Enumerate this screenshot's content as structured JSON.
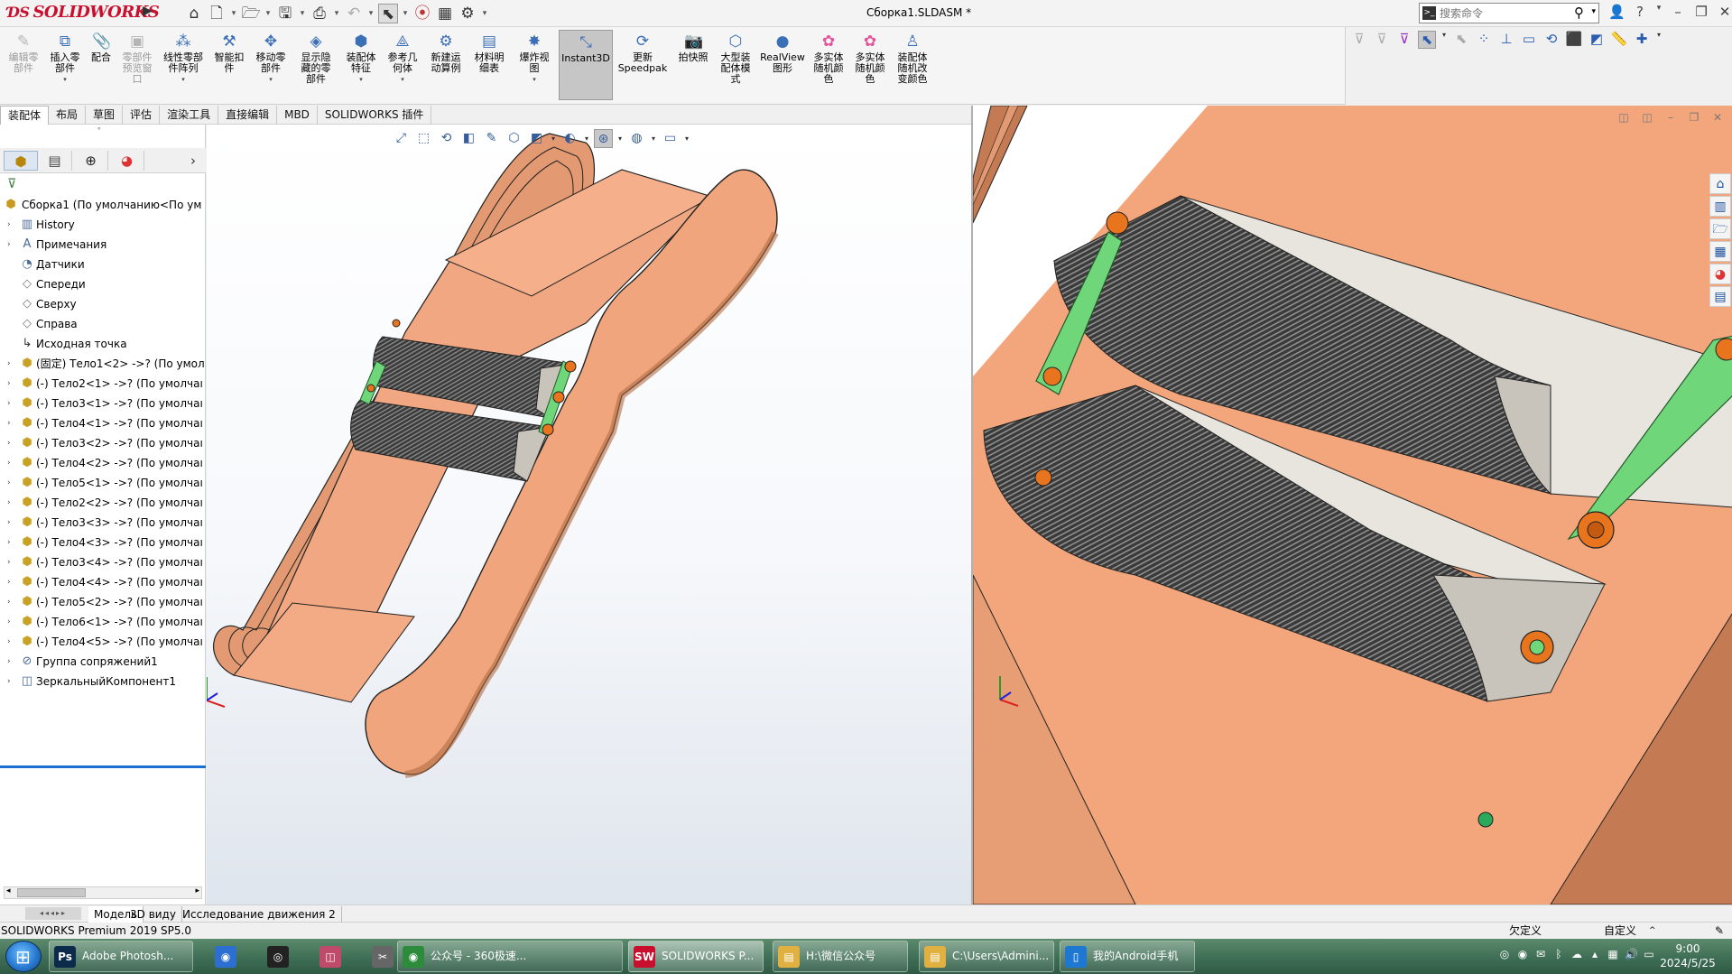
{
  "app": {
    "logo": "SOLIDWORKS",
    "document_title": "Сборка1.SLDASM *"
  },
  "search": {
    "placeholder": "搜索命令"
  },
  "ribbon": {
    "buttons": [
      {
        "label": "编辑零\n部件",
        "disabled": true
      },
      {
        "label": "插入零\n部件",
        "disabled": false
      },
      {
        "label": "配合",
        "disabled": false
      },
      {
        "label": "零部件\n预览窗\n口",
        "disabled": true
      },
      {
        "label": "线性零部\n件阵列",
        "disabled": false
      },
      {
        "label": "智能扣\n件",
        "disabled": false
      },
      {
        "label": "移动零\n部件",
        "disabled": false
      },
      {
        "label": "显示隐\n藏的零\n部件",
        "disabled": false
      },
      {
        "label": "装配体\n特征",
        "disabled": false
      },
      {
        "label": "参考几\n何体",
        "disabled": false
      },
      {
        "label": "新建运\n动算例",
        "disabled": false
      },
      {
        "label": "材料明\n细表",
        "disabled": false
      },
      {
        "label": "爆炸视\n图",
        "disabled": false
      },
      {
        "label": "Instant3D",
        "disabled": false
      },
      {
        "label": "更新\nSpeedpak",
        "disabled": false
      },
      {
        "label": "拍快照",
        "disabled": false
      },
      {
        "label": "大型装\n配体模\n式",
        "disabled": false
      },
      {
        "label": "RealView\n图形",
        "disabled": false
      },
      {
        "label": "多实体\n随机颜\n色",
        "disabled": false
      },
      {
        "label": "多实体\n随机颜\n色",
        "disabled": false
      },
      {
        "label": "装配体\n随机改\n变颜色",
        "disabled": false
      }
    ]
  },
  "tabs": [
    "装配体",
    "布局",
    "草图",
    "评估",
    "渲染工具",
    "直接编辑",
    "MBD",
    "SOLIDWORKS 插件"
  ],
  "feature_tree": {
    "root": "Сборка1  (По умолчанию<По ум",
    "items": [
      {
        "label": "History",
        "icon": "history-folder-icon"
      },
      {
        "label": "Примечания",
        "icon": "annotations-icon"
      },
      {
        "label": "Датчики",
        "icon": "sensors-icon"
      },
      {
        "label": "Спереди",
        "icon": "plane-icon"
      },
      {
        "label": "Сверху",
        "icon": "plane-icon"
      },
      {
        "label": "Справа",
        "icon": "plane-icon"
      },
      {
        "label": "Исходная точка",
        "icon": "origin-icon"
      },
      {
        "label": "(固定) Тело1<2> ->? (По умол",
        "icon": "part-icon"
      },
      {
        "label": "(-) Тело2<1> ->? (По умолчаı",
        "icon": "part-icon"
      },
      {
        "label": "(-) Тело3<1> ->? (По умолчаı",
        "icon": "part-icon"
      },
      {
        "label": "(-) Тело4<1> ->? (По умолчаı",
        "icon": "part-icon"
      },
      {
        "label": "(-) Тело3<2> ->? (По умолчаı",
        "icon": "part-icon"
      },
      {
        "label": "(-) Тело4<2> ->? (По умолчаı",
        "icon": "part-icon"
      },
      {
        "label": "(-) Тело5<1> ->? (По умолчаı",
        "icon": "part-icon"
      },
      {
        "label": "(-) Тело2<2> ->? (По умолчаı",
        "icon": "part-icon"
      },
      {
        "label": "(-) Тело3<3> ->? (По умолчаı",
        "icon": "part-icon"
      },
      {
        "label": "(-) Тело4<3> ->? (По умолчаı",
        "icon": "part-icon"
      },
      {
        "label": "(-) Тело3<4> ->? (По умолчаı",
        "icon": "part-icon"
      },
      {
        "label": "(-) Тело4<4> ->? (По умолчаı",
        "icon": "part-icon"
      },
      {
        "label": "(-) Тело5<2> ->? (По умолчаı",
        "icon": "part-icon"
      },
      {
        "label": "(-) Тело6<1> ->? (По умолчаı",
        "icon": "part-icon"
      },
      {
        "label": "(-) Тело4<5> ->? (По умолчаı",
        "icon": "part-icon"
      },
      {
        "label": "Группа сопряжений1",
        "icon": "mates-icon"
      },
      {
        "label": "ЗеркальныйКомпонент1",
        "icon": "mirror-component-icon"
      }
    ]
  },
  "bottom_tabs": [
    "Модель",
    "3D виду",
    "Исследование движения 2"
  ],
  "status": {
    "left": "SOLIDWORKS Premium 2019 SP5.0",
    "state": "欠定义",
    "custom": "自定义",
    "caret": "^"
  },
  "taskbar": {
    "items": [
      {
        "label": "Adobe Photosh...",
        "icon": "photoshop-icon",
        "color": "#0c2a4a",
        "glyph": "Ps"
      },
      {
        "label": "公众号 - 360极速...",
        "icon": "browser-360-icon",
        "color": "#2d8c3c",
        "glyph": "◉"
      },
      {
        "label": "SOLIDWORKS P...",
        "icon": "solidworks-icon",
        "color": "#c8102e",
        "glyph": "SW"
      },
      {
        "label": "H:\\微信公众号",
        "icon": "folder-icon",
        "color": "#e0b040",
        "glyph": "▤"
      },
      {
        "label": "C:\\Users\\Admini...",
        "icon": "folder-icon",
        "color": "#e0b040",
        "glyph": "▤"
      },
      {
        "label": "我的Android手机",
        "icon": "android-phone-icon",
        "color": "#1e78d2",
        "glyph": "▯"
      }
    ],
    "time": "9:00",
    "date": "2024/5/25"
  },
  "colors": {
    "body_orange": "#f4a77c",
    "body_dark": "#c47a52",
    "roller_gray": "#4a4a4a",
    "link_green": "#6fd67a",
    "bushing_orange": "#e8741e"
  }
}
